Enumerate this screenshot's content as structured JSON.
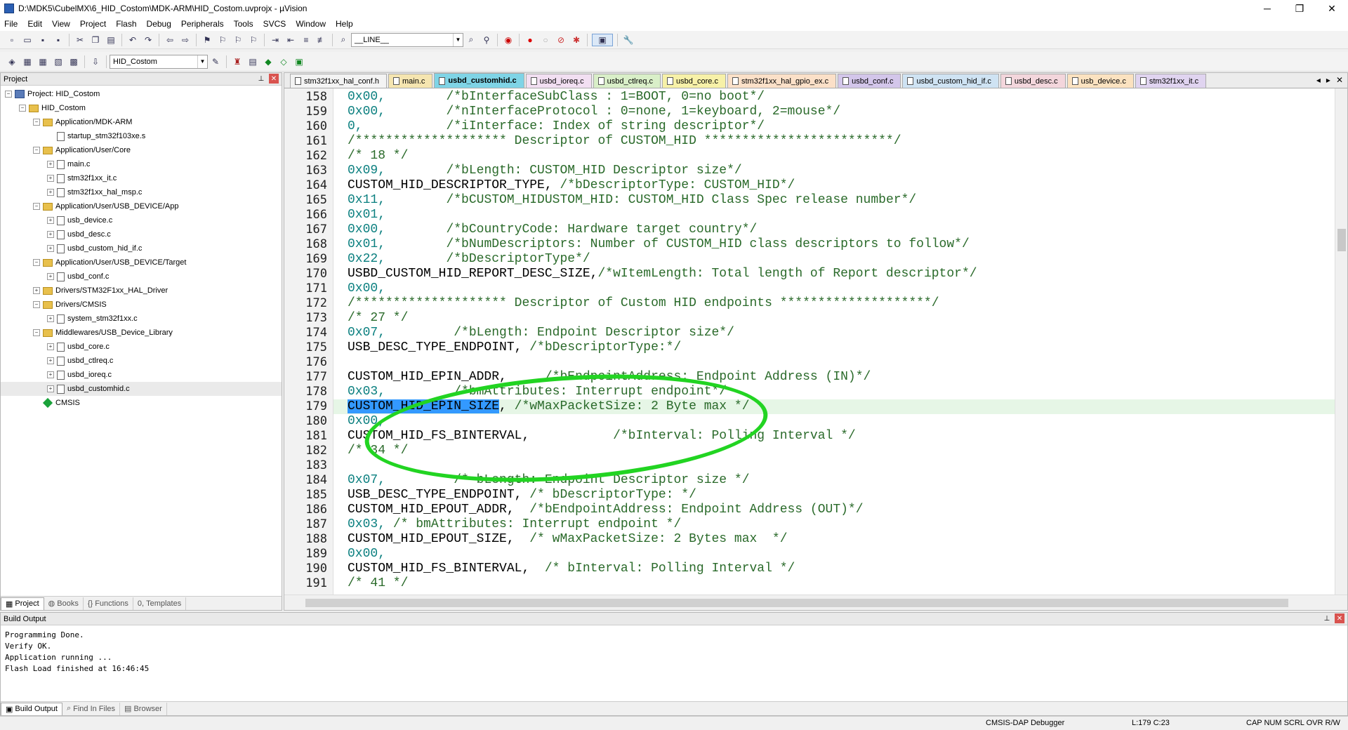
{
  "window": {
    "title": "D:\\MDK5\\CubelMX\\6_HID_Costom\\MDK-ARM\\HID_Costom.uvprojx - µVision",
    "controls": [
      "─",
      "❐",
      "✕"
    ]
  },
  "menu": [
    "File",
    "Edit",
    "View",
    "Project",
    "Flash",
    "Debug",
    "Peripherals",
    "Tools",
    "SVCS",
    "Window",
    "Help"
  ],
  "toolbar": {
    "find_combo": "__LINE__",
    "target_combo": "HID_Costom"
  },
  "project_panel": {
    "title": "Project",
    "tree": [
      {
        "label": "Project: HID_Costom",
        "level": 0,
        "kind": "project",
        "exp": "−"
      },
      {
        "label": "HID_Costom",
        "level": 1,
        "kind": "folder",
        "exp": "−"
      },
      {
        "label": "Application/MDK-ARM",
        "level": 2,
        "kind": "folder",
        "exp": "−"
      },
      {
        "label": "startup_stm32f103xe.s",
        "level": 3,
        "kind": "file",
        "exp": ""
      },
      {
        "label": "Application/User/Core",
        "level": 2,
        "kind": "folder",
        "exp": "−"
      },
      {
        "label": "main.c",
        "level": 3,
        "kind": "file",
        "exp": "+"
      },
      {
        "label": "stm32f1xx_it.c",
        "level": 3,
        "kind": "file",
        "exp": "+"
      },
      {
        "label": "stm32f1xx_hal_msp.c",
        "level": 3,
        "kind": "file",
        "exp": "+"
      },
      {
        "label": "Application/User/USB_DEVICE/App",
        "level": 2,
        "kind": "folder",
        "exp": "−"
      },
      {
        "label": "usb_device.c",
        "level": 3,
        "kind": "file",
        "exp": "+"
      },
      {
        "label": "usbd_desc.c",
        "level": 3,
        "kind": "file",
        "exp": "+"
      },
      {
        "label": "usbd_custom_hid_if.c",
        "level": 3,
        "kind": "file",
        "exp": "+"
      },
      {
        "label": "Application/User/USB_DEVICE/Target",
        "level": 2,
        "kind": "folder",
        "exp": "−"
      },
      {
        "label": "usbd_conf.c",
        "level": 3,
        "kind": "file",
        "exp": "+"
      },
      {
        "label": "Drivers/STM32F1xx_HAL_Driver",
        "level": 2,
        "kind": "folder",
        "exp": "+"
      },
      {
        "label": "Drivers/CMSIS",
        "level": 2,
        "kind": "folder",
        "exp": "−"
      },
      {
        "label": "system_stm32f1xx.c",
        "level": 3,
        "kind": "file",
        "exp": "+"
      },
      {
        "label": "Middlewares/USB_Device_Library",
        "level": 2,
        "kind": "folder",
        "exp": "−"
      },
      {
        "label": "usbd_core.c",
        "level": 3,
        "kind": "file",
        "exp": "+"
      },
      {
        "label": "usbd_ctlreq.c",
        "level": 3,
        "kind": "file",
        "exp": "+"
      },
      {
        "label": "usbd_ioreq.c",
        "level": 3,
        "kind": "file",
        "exp": "+"
      },
      {
        "label": "usbd_customhid.c",
        "level": 3,
        "kind": "file",
        "exp": "+"
      },
      {
        "label": "CMSIS",
        "level": 2,
        "kind": "diamond",
        "exp": ""
      }
    ],
    "tabs": [
      "Project",
      "Books",
      "Functions",
      "Templates"
    ]
  },
  "editor": {
    "tabs": [
      {
        "label": "stm32f1xx_hal_conf.h",
        "color": "#f3f3f3"
      },
      {
        "label": "main.c",
        "color": "#f5e5b0"
      },
      {
        "label": "usbd_customhid.c",
        "color": "#7fd4e6",
        "active": true
      },
      {
        "label": "usbd_ioreq.c",
        "color": "#f2dff2"
      },
      {
        "label": "usbd_ctlreq.c",
        "color": "#d9efc8"
      },
      {
        "label": "usbd_core.c",
        "color": "#f7f1a8"
      },
      {
        "label": "stm32f1xx_hal_gpio_ex.c",
        "color": "#fbe0c8"
      },
      {
        "label": "usbd_conf.c",
        "color": "#d3c6ea"
      },
      {
        "label": "usbd_custom_hid_if.c",
        "color": "#cfe3f3"
      },
      {
        "label": "usbd_desc.c",
        "color": "#f3d6dc"
      },
      {
        "label": "usb_device.c",
        "color": "#fbe2c0"
      },
      {
        "label": "stm32f1xx_it.c",
        "color": "#e0d4f0"
      }
    ],
    "current_line": 179,
    "lines": [
      {
        "n": "158",
        "segs": [
          [
            "num",
            "0x00,"
          ],
          [
            "sp",
            "        "
          ],
          [
            "cmt",
            "/*bInterfaceSubClass : 1=BOOT, 0=no boot*/"
          ]
        ]
      },
      {
        "n": "159",
        "segs": [
          [
            "num",
            "0x00,"
          ],
          [
            "sp",
            "        "
          ],
          [
            "cmt",
            "/*nInterfaceProtocol : 0=none, 1=keyboard, 2=mouse*/"
          ]
        ]
      },
      {
        "n": "160",
        "segs": [
          [
            "num",
            "0,"
          ],
          [
            "sp",
            "           "
          ],
          [
            "cmt",
            "/*iInterface: Index of string descriptor*/"
          ]
        ]
      },
      {
        "n": "161",
        "segs": [
          [
            "cmt",
            "/******************** Descriptor of CUSTOM_HID *************************/"
          ]
        ]
      },
      {
        "n": "162",
        "segs": [
          [
            "cmt",
            "/* 18 */"
          ]
        ]
      },
      {
        "n": "163",
        "segs": [
          [
            "num",
            "0x09,"
          ],
          [
            "sp",
            "        "
          ],
          [
            "cmt",
            "/*bLength: CUSTOM_HID Descriptor size*/"
          ]
        ]
      },
      {
        "n": "164",
        "segs": [
          [
            "id",
            "CUSTOM_HID_DESCRIPTOR_TYPE, "
          ],
          [
            "cmt",
            "/*bDescriptorType: CUSTOM_HID*/"
          ]
        ]
      },
      {
        "n": "165",
        "segs": [
          [
            "num",
            "0x11,"
          ],
          [
            "sp",
            "        "
          ],
          [
            "cmt",
            "/*bCUSTOM_HIDUSTOM_HID: CUSTOM_HID Class Spec release number*/"
          ]
        ]
      },
      {
        "n": "166",
        "segs": [
          [
            "num",
            "0x01,"
          ]
        ]
      },
      {
        "n": "167",
        "segs": [
          [
            "num",
            "0x00,"
          ],
          [
            "sp",
            "        "
          ],
          [
            "cmt",
            "/*bCountryCode: Hardware target country*/"
          ]
        ]
      },
      {
        "n": "168",
        "segs": [
          [
            "num",
            "0x01,"
          ],
          [
            "sp",
            "        "
          ],
          [
            "cmt",
            "/*bNumDescriptors: Number of CUSTOM_HID class descriptors to follow*/"
          ]
        ]
      },
      {
        "n": "169",
        "segs": [
          [
            "num",
            "0x22,"
          ],
          [
            "sp",
            "        "
          ],
          [
            "cmt",
            "/*bDescriptorType*/"
          ]
        ]
      },
      {
        "n": "170",
        "segs": [
          [
            "id",
            "USBD_CUSTOM_HID_REPORT_DESC_SIZE,"
          ],
          [
            "cmt",
            "/*wItemLength: Total length of Report descriptor*/"
          ]
        ]
      },
      {
        "n": "171",
        "segs": [
          [
            "num",
            "0x00,"
          ]
        ]
      },
      {
        "n": "172",
        "segs": [
          [
            "cmt",
            "/******************** Descriptor of Custom HID endpoints ********************/"
          ]
        ]
      },
      {
        "n": "173",
        "segs": [
          [
            "cmt",
            "/* 27 */"
          ]
        ]
      },
      {
        "n": "174",
        "segs": [
          [
            "num",
            "0x07,"
          ],
          [
            "sp",
            "         "
          ],
          [
            "cmt",
            "/*bLength: Endpoint Descriptor size*/"
          ]
        ]
      },
      {
        "n": "175",
        "segs": [
          [
            "id",
            "USB_DESC_TYPE_ENDPOINT, "
          ],
          [
            "cmt",
            "/*bDescriptorType:*/"
          ]
        ]
      },
      {
        "n": "176",
        "segs": []
      },
      {
        "n": "177",
        "segs": [
          [
            "id",
            "CUSTOM_HID_EPIN_ADDR,     "
          ],
          [
            "cmt",
            "/*bEndpointAddress: Endpoint Address (IN)*/"
          ]
        ]
      },
      {
        "n": "178",
        "segs": [
          [
            "num",
            "0x03,"
          ],
          [
            "sp",
            "         "
          ],
          [
            "cmt",
            "/*bmAttributes: Interrupt endpoint*/"
          ]
        ]
      },
      {
        "n": "179",
        "segs": [
          [
            "sel",
            "CUSTOM_HID_EPIN_SIZE"
          ],
          [
            "id",
            ", "
          ],
          [
            "cmt",
            "/*wMaxPacketSize: 2 Byte max */"
          ]
        ]
      },
      {
        "n": "180",
        "segs": [
          [
            "num",
            "0x00,"
          ]
        ]
      },
      {
        "n": "181",
        "segs": [
          [
            "id",
            "CUSTOM_HID_FS_BINTERVAL,           "
          ],
          [
            "cmt",
            "/*bInterval: Polling Interval */"
          ]
        ]
      },
      {
        "n": "182",
        "segs": [
          [
            "cmt",
            "/* 34 */"
          ]
        ]
      },
      {
        "n": "183",
        "segs": []
      },
      {
        "n": "184",
        "segs": [
          [
            "num",
            "0x07,"
          ],
          [
            "sp",
            "         "
          ],
          [
            "cmt",
            "/* bLength: Endpoint Descriptor size */"
          ]
        ]
      },
      {
        "n": "185",
        "segs": [
          [
            "id",
            "USB_DESC_TYPE_ENDPOINT, "
          ],
          [
            "cmt",
            "/* bDescriptorType: */"
          ]
        ]
      },
      {
        "n": "186",
        "segs": [
          [
            "id",
            "CUSTOM_HID_EPOUT_ADDR,  "
          ],
          [
            "cmt",
            "/*bEndpointAddress: Endpoint Address (OUT)*/"
          ]
        ]
      },
      {
        "n": "187",
        "segs": [
          [
            "num",
            "0x03, "
          ],
          [
            "cmt",
            "/* bmAttributes: Interrupt endpoint */"
          ]
        ]
      },
      {
        "n": "188",
        "segs": [
          [
            "id",
            "CUSTOM_HID_EPOUT_SIZE,  "
          ],
          [
            "cmt",
            "/* wMaxPacketSize: 2 Bytes max  */"
          ]
        ]
      },
      {
        "n": "189",
        "segs": [
          [
            "num",
            "0x00,"
          ]
        ]
      },
      {
        "n": "190",
        "segs": [
          [
            "id",
            "CUSTOM_HID_FS_BINTERVAL,  "
          ],
          [
            "cmt",
            "/* bInterval: Polling Interval */"
          ]
        ]
      },
      {
        "n": "191",
        "segs": [
          [
            "cmt",
            "/* 41 */"
          ]
        ]
      }
    ]
  },
  "build_output": {
    "title": "Build Output",
    "lines": [
      "Programming Done.",
      "Verify OK.",
      "Application running ...",
      "Flash Load finished at 16:46:45"
    ],
    "tabs": [
      "Build Output",
      "Find In Files",
      "Browser"
    ]
  },
  "status": {
    "debugger": "CMSIS-DAP Debugger",
    "position": "L:179 C:23",
    "flags": "CAP  NUM  SCRL  OVR  R/W"
  }
}
